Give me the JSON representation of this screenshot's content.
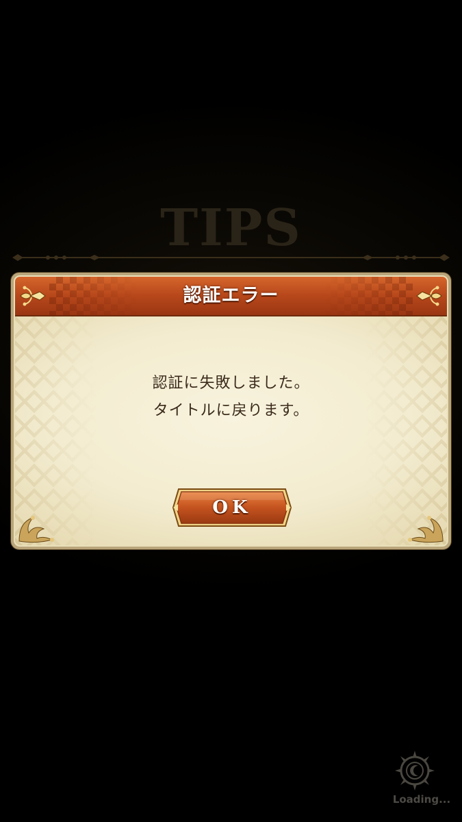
{
  "background": {
    "tips_label": "TIPS"
  },
  "dialog": {
    "title": "認証エラー",
    "message_lines": [
      "認証に失敗しました。",
      "タイトルに戻ります。"
    ],
    "ok_label": "OK"
  },
  "loading": {
    "label": "Loading..."
  },
  "colors": {
    "header": "#b8481b",
    "panel": "#f6f1da",
    "frame": "#b9a57a",
    "button": "#c4531f"
  },
  "icons": [
    "fleur-ornament-icon",
    "corner-ornament-icon",
    "compass-loading-icon"
  ]
}
